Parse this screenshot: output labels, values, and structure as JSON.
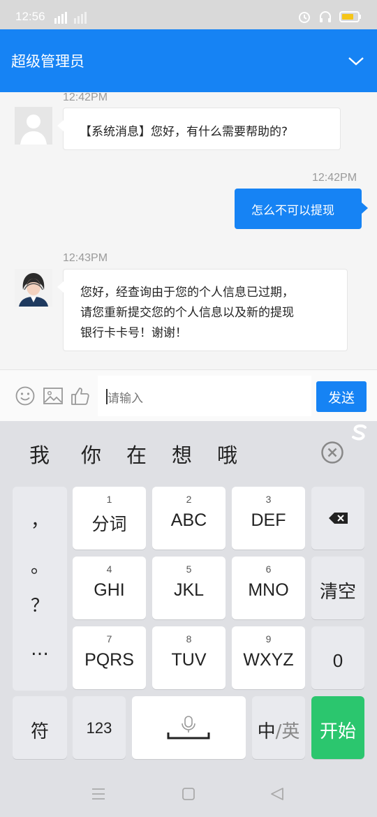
{
  "status_bar": {
    "time": "12:56"
  },
  "header": {
    "title": "超级管理员"
  },
  "chat": {
    "messages": [
      {
        "direction": "in",
        "time": "12:42PM",
        "text": "【系统消息】您好，有什么需要帮助的?",
        "avatar": "default-avatar"
      },
      {
        "direction": "out",
        "time": "12:42PM",
        "text": "怎么不可以提现"
      },
      {
        "direction": "in",
        "time": "12:43PM",
        "lines": [
          "您好，经查询由于您的个人信息已过期，",
          "请您重新提交您的个人信息以及新的提现",
          "银行卡卡号！谢谢！"
        ],
        "avatar": "agent-avatar"
      }
    ]
  },
  "input_bar": {
    "placeholder": "请输入",
    "send_label": "发送"
  },
  "keyboard": {
    "candidates": [
      "我",
      "你",
      "在",
      "想",
      "哦"
    ],
    "punctuation": [
      "，",
      "。",
      "？",
      "…"
    ],
    "keys": [
      {
        "num": "1",
        "label": "分词"
      },
      {
        "num": "2",
        "label": "ABC"
      },
      {
        "num": "3",
        "label": "DEF"
      },
      {
        "num": "4",
        "label": "GHI"
      },
      {
        "num": "5",
        "label": "JKL"
      },
      {
        "num": "6",
        "label": "MNO"
      },
      {
        "num": "7",
        "label": "PQRS"
      },
      {
        "num": "8",
        "label": "TUV"
      },
      {
        "num": "9",
        "label": "WXYZ"
      }
    ],
    "clear_label": "清空",
    "zero_label": "0",
    "symbol_label": "符",
    "num_label": "123",
    "lang_cn": "中",
    "lang_sep": "/",
    "lang_en": "英",
    "go_label": "开始"
  },
  "colors": {
    "accent": "#1683f4",
    "go": "#2bc66e"
  }
}
